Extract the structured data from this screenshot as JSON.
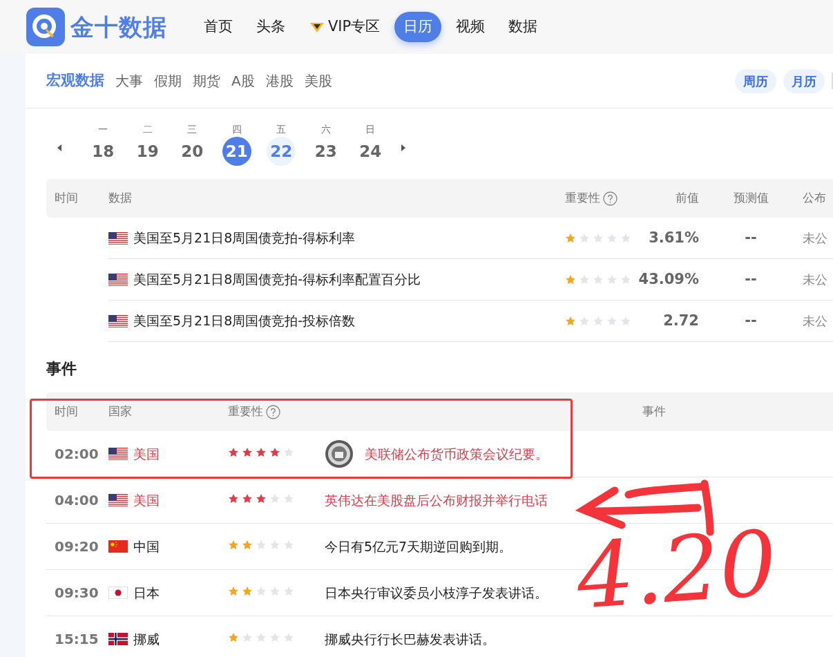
{
  "logo": {
    "text": "金十数据"
  },
  "nav": [
    {
      "label": "首页",
      "selected": false,
      "kind": "plain"
    },
    {
      "label": "头条",
      "selected": false,
      "kind": "plain"
    },
    {
      "label": "VIP专区",
      "selected": false,
      "kind": "vip"
    },
    {
      "label": "日历",
      "selected": true,
      "kind": "plain"
    },
    {
      "label": "视频",
      "selected": false,
      "kind": "plain"
    },
    {
      "label": "数据",
      "selected": false,
      "kind": "plain"
    }
  ],
  "subtabs": [
    {
      "label": "宏观数据",
      "selected": true
    },
    {
      "label": "大事",
      "selected": false
    },
    {
      "label": "假期",
      "selected": false
    },
    {
      "label": "期货",
      "selected": false
    },
    {
      "label": "A股",
      "selected": false
    },
    {
      "label": "港股",
      "selected": false
    },
    {
      "label": "美股",
      "selected": false
    }
  ],
  "view_buttons": [
    "周历",
    "月历"
  ],
  "week": [
    {
      "weekday": "一",
      "date": "18",
      "selected": false,
      "highlighted": false
    },
    {
      "weekday": "二",
      "date": "19",
      "selected": false,
      "highlighted": false
    },
    {
      "weekday": "三",
      "date": "20",
      "selected": false,
      "highlighted": false
    },
    {
      "weekday": "四",
      "date": "21",
      "selected": true,
      "highlighted": false
    },
    {
      "weekday": "五",
      "date": "22",
      "selected": false,
      "highlighted": true
    },
    {
      "weekday": "六",
      "date": "23",
      "selected": false,
      "highlighted": false
    },
    {
      "weekday": "日",
      "date": "24",
      "selected": false,
      "highlighted": false
    }
  ],
  "data_table": {
    "columns": [
      "时间",
      "数据",
      "重要性",
      "前值",
      "预测值",
      "公布"
    ],
    "rows": [
      {
        "kind": "us",
        "name": "美国至5月21日8周国债竞拍-得标利率",
        "stars": 1,
        "previous": "3.61%",
        "forecast": "--",
        "actual": "未公"
      },
      {
        "kind": "us",
        "name": "美国至5月21日8周国债竞拍-得标利率配置百分比",
        "stars": 1,
        "previous": "43.09%",
        "forecast": "--",
        "actual": "未公"
      },
      {
        "kind": "us",
        "name": "美国至5月21日8周国债竞拍-投标倍数",
        "stars": 1,
        "previous": "2.72",
        "forecast": "--",
        "actual": "未公"
      }
    ]
  },
  "events_section": {
    "title": "事件",
    "columns": [
      "时间",
      "国家",
      "重要性",
      "事件"
    ],
    "rows": [
      {
        "time": "02:00",
        "kind": "us",
        "country": "美国",
        "stars": 4,
        "highlight": true,
        "seal": true,
        "event": "美联储公布货币政策会议纪要。"
      },
      {
        "time": "04:00",
        "kind": "us",
        "country": "美国",
        "stars": 3,
        "highlight": true,
        "seal": false,
        "event": "英伟达在美股盘后公布财报并举行电话"
      },
      {
        "time": "09:20",
        "kind": "cn",
        "country": "中国",
        "stars": 2,
        "highlight": false,
        "seal": false,
        "event": "今日有5亿元7天期逆回购到期。"
      },
      {
        "time": "09:30",
        "kind": "jp",
        "country": "日本",
        "stars": 2,
        "highlight": false,
        "seal": false,
        "event": "日本央行审议委员小枝淳子发表讲话。"
      },
      {
        "time": "15:15",
        "kind": "no",
        "country": "挪威",
        "stars": 1,
        "highlight": false,
        "seal": false,
        "event": "挪威央行行长巴赫发表讲话。"
      }
    ]
  },
  "annotation": {
    "note": "4.20"
  }
}
